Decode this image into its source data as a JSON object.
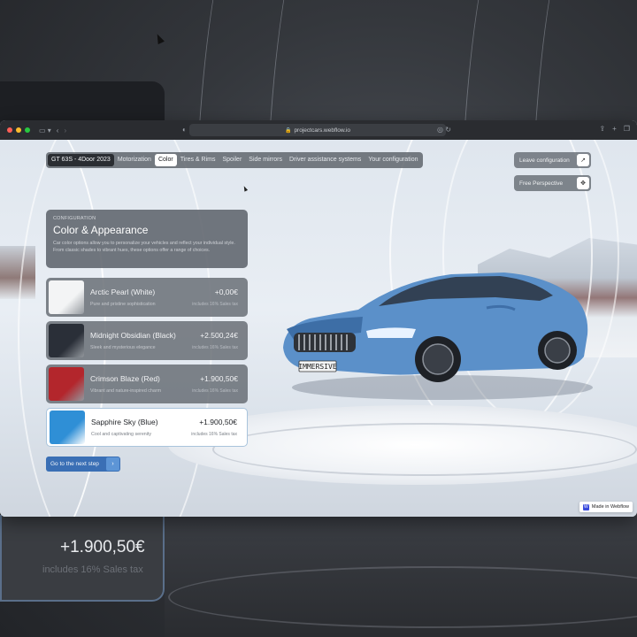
{
  "background": {
    "price": "+1.900,50€",
    "tax": "includes 16% Sales tax"
  },
  "browser": {
    "url": "projectcars.webflow.io",
    "traffic_lights": [
      "#ff5f57",
      "#febc2e",
      "#28c840"
    ]
  },
  "nav": {
    "items": [
      {
        "label": "GT 63S - 4Door 2023",
        "state": "brand"
      },
      {
        "label": "Motorization",
        "state": "normal"
      },
      {
        "label": "Color",
        "state": "active"
      },
      {
        "label": "Tires & Rims",
        "state": "normal"
      },
      {
        "label": "Spoiler",
        "state": "normal"
      },
      {
        "label": "Side mirrors",
        "state": "normal"
      },
      {
        "label": "Driver assistance systems",
        "state": "normal"
      },
      {
        "label": "Your configuration",
        "state": "normal"
      }
    ]
  },
  "actions": {
    "leave_label": "Leave configuration",
    "leave_icon": "external-link-icon",
    "perspective_label": "Free Perspective",
    "perspective_icon": "move-icon"
  },
  "config": {
    "eyebrow": "CONFIGURATION",
    "title": "Color & Appearance",
    "description": "Car color options allow you to personalize your vehicles and reflect your individual style. From classic shades to vibrant hues, these options offer a range of choices."
  },
  "options": [
    {
      "name": "Arctic Pearl (White)",
      "subtitle": "Pure and pristine sophistication",
      "price": "+0,00€",
      "tax": "includes 16% Sales tax",
      "color": "#f3f4f5",
      "selected": false
    },
    {
      "name": "Midnight Obsidian (Black)",
      "subtitle": "Sleek and mysterious elegance",
      "price": "+2.500,24€",
      "tax": "includes 16% Sales tax",
      "color": "#2a2f38",
      "selected": false
    },
    {
      "name": "Crimson Blaze (Red)",
      "subtitle": "Vibrant and nature-inspired charm",
      "price": "+1.900,50€",
      "tax": "includes 16% Sales tax",
      "color": "#b3262c",
      "selected": false
    },
    {
      "name": "Sapphire Sky (Blue)",
      "subtitle": "Cool and captivating serenity",
      "price": "+1.900,50€",
      "tax": "includes 16% Sales tax",
      "color": "#2f8fd6",
      "selected": true
    }
  ],
  "next_button": {
    "label": "Go to the next step",
    "icon": "chevron-right-icon"
  },
  "plate": "IMMERSIVE",
  "badge": {
    "label": "Made in Webflow"
  },
  "colors": {
    "accent": "#3a6fb5",
    "car_body": "#5b90c9"
  }
}
